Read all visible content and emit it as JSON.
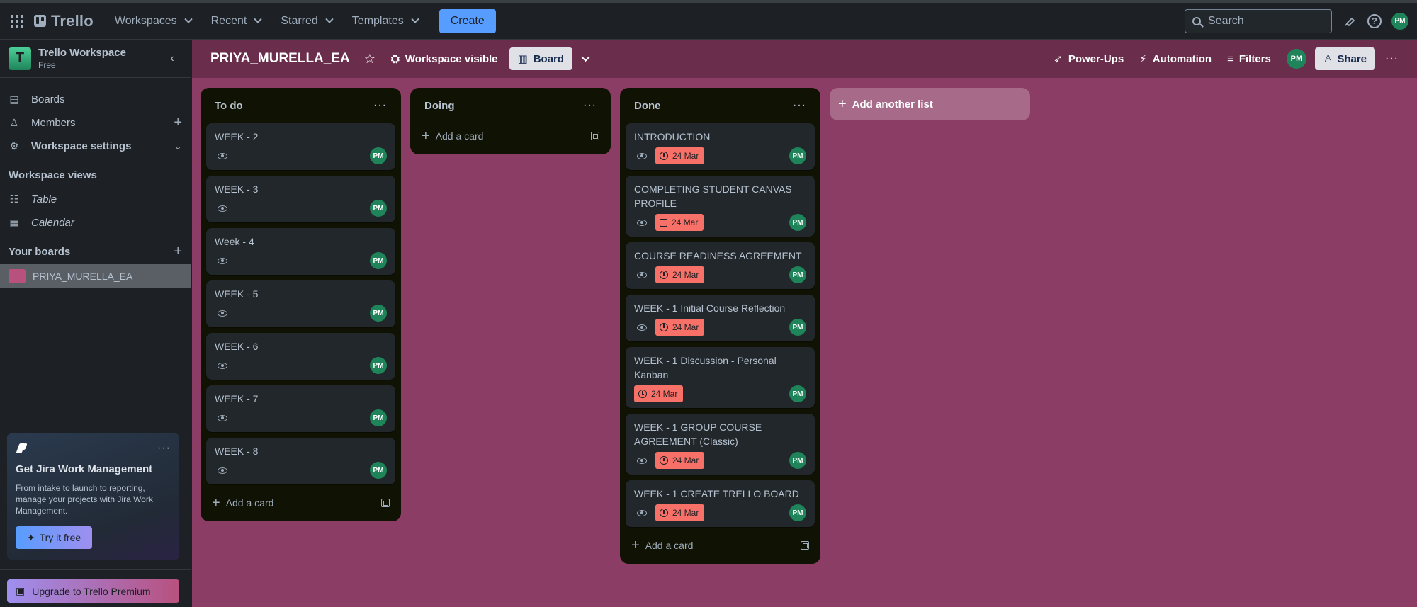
{
  "topbar": {
    "logo": "Trello",
    "nav": [
      {
        "label": "Workspaces"
      },
      {
        "label": "Recent"
      },
      {
        "label": "Starred"
      },
      {
        "label": "Templates"
      }
    ],
    "create_label": "Create",
    "search_placeholder": "Search",
    "user_initials": "PM"
  },
  "sidebar": {
    "workspace_initial": "T",
    "workspace_name": "Trello Workspace",
    "workspace_plan": "Free",
    "items": [
      {
        "label": "Boards",
        "icon": "trello-boards-icon"
      },
      {
        "label": "Members",
        "icon": "members-icon"
      },
      {
        "label": "Workspace settings",
        "icon": "gear-icon"
      }
    ],
    "views_header": "Workspace views",
    "views": [
      {
        "label": "Table",
        "icon": "table-icon"
      },
      {
        "label": "Calendar",
        "icon": "calendar-icon"
      }
    ],
    "boards_header": "Your boards",
    "boards": [
      {
        "label": "PRIYA_MURELLA_EA",
        "color": "#b8517e"
      }
    ],
    "jira": {
      "title": "Get Jira Work Management",
      "desc": "From intake to launch to reporting, manage your projects with Jira Work Management.",
      "button": "Try it free"
    },
    "upgrade_label": "Upgrade to Trello Premium"
  },
  "board": {
    "title": "PRIYA_MURELLA_EA",
    "visibility": "Workspace visible",
    "view_label": "Board",
    "power_ups": "Power-Ups",
    "automation": "Automation",
    "filters": "Filters",
    "member_initials": "PM",
    "share": "Share",
    "background_color": "#8c3d65",
    "add_list_label": "Add another list",
    "lists": [
      {
        "title": "To do",
        "add_card": "Add a card",
        "cards": [
          {
            "title": "WEEK - 2",
            "due": "",
            "member": "PM"
          },
          {
            "title": "WEEK - 3",
            "due": "",
            "member": "PM"
          },
          {
            "title": "Week - 4",
            "due": "",
            "member": "PM"
          },
          {
            "title": "WEEK - 5",
            "due": "",
            "member": "PM"
          },
          {
            "title": "WEEK - 6",
            "due": "",
            "member": "PM"
          },
          {
            "title": "WEEK - 7",
            "due": "",
            "member": "PM"
          },
          {
            "title": "WEEK - 8",
            "due": "",
            "member": "PM"
          }
        ]
      },
      {
        "title": "Doing",
        "add_card": "Add a card",
        "cards": []
      },
      {
        "title": "Done",
        "add_card": "Add a card",
        "cards": [
          {
            "title": "INTRODUCTION",
            "due": "24 Mar",
            "member": "PM"
          },
          {
            "title": "COMPLETING STUDENT CANVAS PROFILE",
            "due": "24 Mar",
            "member": "PM"
          },
          {
            "title": "COURSE READINESS AGREEMENT",
            "due": "24 Mar",
            "member": "PM"
          },
          {
            "title": "WEEK - 1 Initial Course Reflection",
            "due": "24 Mar",
            "member": "PM"
          },
          {
            "title": "WEEK - 1 Discussion - Personal Kanban",
            "due": "24 Mar",
            "member": "PM"
          },
          {
            "title": "WEEK - 1 GROUP COURSE AGREEMENT (Classic)",
            "due": "24 Mar",
            "member": "PM"
          },
          {
            "title": "WEEK - 1 CREATE TRELLO BOARD",
            "due": "24 Mar",
            "member": "PM"
          }
        ]
      }
    ]
  }
}
